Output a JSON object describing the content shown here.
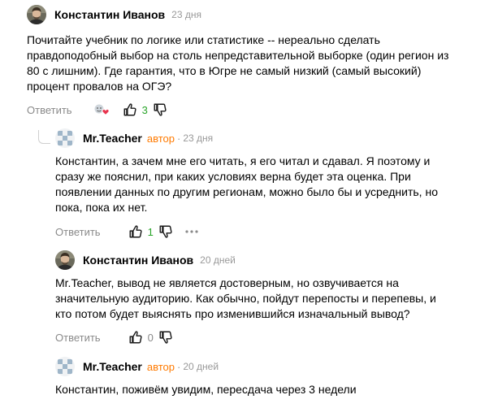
{
  "comments": [
    {
      "author": "Константин Иванов",
      "date": "23 дня",
      "text_lines": [
        "Почитайте учебник по логике или статистике -- нереально сделать",
        "правдоподобный выбор на столь непредставительной выборке (один регион из",
        "80 с лишним). Где гарантия, что в Югре не самый низкий (самый высокий)",
        "процент провалов на ОГЭ?"
      ],
      "reply_label": "Ответить",
      "likes": "3"
    },
    {
      "author": "Mr.Teacher",
      "role": "автор",
      "separator": "·",
      "date": "23 дня",
      "text_lines": [
        "Константин, а зачем мне его читать, я его читал и сдавал. Я поэтому и",
        "сразу же пояснил, при каких условиях верна будет эта оценка. При",
        "появлении данных по другим регионам, можно было бы и усреднить, но",
        "пока, пока их нет."
      ],
      "reply_label": "Ответить",
      "likes": "1"
    },
    {
      "author": "Константин Иванов",
      "date": "20 дней",
      "text_lines": [
        "Mr.Teacher, вывод не является достоверным, но озвучивается на",
        "значительную аудиторию. Как обычно, пойдут перепосты и перепевы, и",
        "кто потом будет выяснять про изменившийся изначальный вывод?"
      ],
      "reply_label": "Ответить",
      "likes": "0"
    },
    {
      "author": "Mr.Teacher",
      "role": "автор",
      "separator": "·",
      "date": "20 дней",
      "text_lines": [
        "Константин, поживём увидим, пересдача через 3 недели"
      ]
    }
  ],
  "icons": {
    "like": "thumb-up-icon",
    "dislike": "thumb-down-icon",
    "more": "more-dots-icon",
    "reactions": "reactions-icon"
  },
  "colors": {
    "author_role": "#ff7a00",
    "positive_count": "#2aa52a",
    "muted": "#999999"
  }
}
